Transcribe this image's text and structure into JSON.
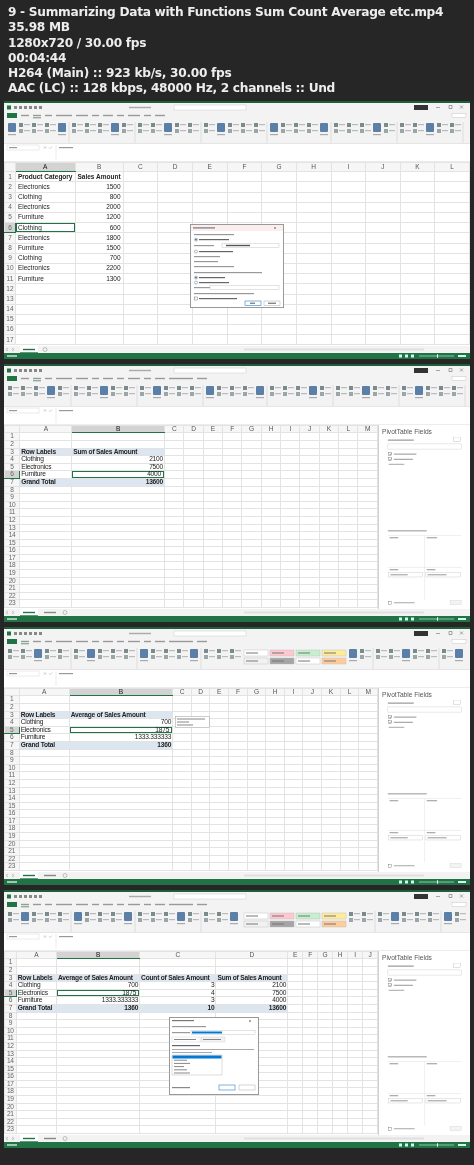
{
  "header": {
    "lines": [
      "9 - Summarizing Data with Functions Sum Count Average etc.mp4",
      "35.98 MB",
      "1280x720 / 30.00 fps",
      "00:04:44",
      "H264 (Main) :: 923 kb/s, 30.00 fps",
      "AAC (LC) :: 128 kbps, 48000 Hz, 2 channels :: Und"
    ]
  },
  "frames": [
    {
      "kind": "source",
      "overlay": {
        "kind": "create_pivot_dialog"
      },
      "columns": [
        {
          "label": "A",
          "selected": true
        },
        {
          "label": "B",
          "selected": false
        },
        {
          "label": "C",
          "selected": false
        },
        {
          "label": "D",
          "selected": false
        },
        {
          "label": "E",
          "selected": false
        },
        {
          "label": "F",
          "selected": false
        },
        {
          "label": "G",
          "selected": false
        },
        {
          "label": "H",
          "selected": false
        },
        {
          "label": "I",
          "selected": false
        },
        {
          "label": "J",
          "selected": false
        },
        {
          "label": "K",
          "selected": false
        },
        {
          "label": "L",
          "selected": false
        }
      ],
      "rows": [
        {
          "label": "1",
          "active": false,
          "kind": "field_header",
          "cells": [
            "Product Category",
            "Sales Amount"
          ]
        },
        {
          "label": "2",
          "active": false,
          "kind": "item",
          "cells": [
            "Electronics",
            "1500"
          ]
        },
        {
          "label": "3",
          "active": false,
          "kind": "item",
          "cells": [
            "Clothing",
            "800"
          ]
        },
        {
          "label": "4",
          "active": false,
          "kind": "item",
          "cells": [
            "Electronics",
            "2000"
          ]
        },
        {
          "label": "5",
          "active": false,
          "kind": "item",
          "cells": [
            "Furniture",
            "1200"
          ]
        },
        {
          "label": "6",
          "active": true,
          "kind": "item",
          "cells": [
            "Clothing",
            "600"
          ]
        },
        {
          "label": "7",
          "active": false,
          "kind": "item",
          "cells": [
            "Electronics",
            "1800"
          ]
        },
        {
          "label": "8",
          "active": false,
          "kind": "item",
          "cells": [
            "Furniture",
            "1500"
          ]
        },
        {
          "label": "9",
          "active": false,
          "kind": "item",
          "cells": [
            "Clothing",
            "700"
          ]
        },
        {
          "label": "10",
          "active": false,
          "kind": "item",
          "cells": [
            "Electronics",
            "2200"
          ]
        },
        {
          "label": "11",
          "active": false,
          "kind": "item",
          "cells": [
            "Furniture",
            "1300"
          ]
        },
        {
          "label": "12",
          "active": false
        },
        {
          "label": "13",
          "active": false
        },
        {
          "label": "14",
          "active": false
        },
        {
          "label": "15",
          "active": false
        },
        {
          "label": "16",
          "active": false
        },
        {
          "label": "17",
          "active": false
        }
      ]
    },
    {
      "kind": "pivot",
      "panel_title": "PivotTable Fields",
      "columns": [
        {
          "label": "A",
          "selected": false
        },
        {
          "label": "B",
          "selected": true
        },
        {
          "label": "C",
          "selected": false
        },
        {
          "label": "D",
          "selected": false
        },
        {
          "label": "E",
          "selected": false
        },
        {
          "label": "F",
          "selected": false
        },
        {
          "label": "G",
          "selected": false
        },
        {
          "label": "H",
          "selected": false
        },
        {
          "label": "I",
          "selected": false
        },
        {
          "label": "J",
          "selected": false
        },
        {
          "label": "K",
          "selected": false
        },
        {
          "label": "L",
          "selected": false
        },
        {
          "label": "M",
          "selected": false
        }
      ],
      "rows": [
        {
          "label": "1",
          "active": false
        },
        {
          "label": "2",
          "active": false
        },
        {
          "label": "3",
          "active": false,
          "kind": "pivot_header",
          "cells": [
            "Row Labels",
            "Sum of Sales Amount"
          ]
        },
        {
          "label": "4",
          "active": false,
          "kind": "item",
          "cells": [
            "Clothing",
            "2100"
          ]
        },
        {
          "label": "5",
          "active": false,
          "kind": "item",
          "cells": [
            "Electronics",
            "7500"
          ]
        },
        {
          "label": "6",
          "active": true,
          "kind": "item",
          "cells": [
            "Furniture",
            "4000"
          ]
        },
        {
          "label": "7",
          "active": false,
          "kind": "total",
          "cells": [
            "Grand Total",
            "13600"
          ]
        },
        {
          "label": "8",
          "active": false
        },
        {
          "label": "9",
          "active": false
        },
        {
          "label": "10",
          "active": false
        },
        {
          "label": "11",
          "active": false
        },
        {
          "label": "12",
          "active": false
        },
        {
          "label": "13",
          "active": false
        },
        {
          "label": "14",
          "active": false
        },
        {
          "label": "15",
          "active": false
        },
        {
          "label": "16",
          "active": false
        },
        {
          "label": "17",
          "active": false
        },
        {
          "label": "18",
          "active": false
        },
        {
          "label": "19",
          "active": false
        },
        {
          "label": "20",
          "active": false
        },
        {
          "label": "21",
          "active": false
        },
        {
          "label": "22",
          "active": false
        },
        {
          "label": "23",
          "active": false
        }
      ]
    },
    {
      "kind": "pivot",
      "panel_title": "PivotTable Fields",
      "overlay": {
        "kind": "tooltip"
      },
      "columns": [
        {
          "label": "A",
          "selected": false
        },
        {
          "label": "B",
          "selected": true
        },
        {
          "label": "C",
          "selected": false
        },
        {
          "label": "D",
          "selected": false
        },
        {
          "label": "E",
          "selected": false
        },
        {
          "label": "F",
          "selected": false
        },
        {
          "label": "G",
          "selected": false
        },
        {
          "label": "H",
          "selected": false
        },
        {
          "label": "I",
          "selected": false
        },
        {
          "label": "J",
          "selected": false
        },
        {
          "label": "K",
          "selected": false
        },
        {
          "label": "L",
          "selected": false
        },
        {
          "label": "M",
          "selected": false
        }
      ],
      "rows": [
        {
          "label": "1",
          "active": false
        },
        {
          "label": "2",
          "active": false
        },
        {
          "label": "3",
          "active": false,
          "kind": "pivot_header",
          "cells": [
            "Row Labels",
            "Average of Sales Amount"
          ]
        },
        {
          "label": "4",
          "active": false,
          "kind": "item",
          "cells": [
            "Clothing",
            "700"
          ]
        },
        {
          "label": "5",
          "active": true,
          "kind": "item",
          "cells": [
            "Electronics",
            "1875"
          ]
        },
        {
          "label": "6",
          "active": false,
          "kind": "item",
          "cells": [
            "Furniture",
            "1333.333333"
          ]
        },
        {
          "label": "7",
          "active": false,
          "kind": "total",
          "cells": [
            "Grand Total",
            "1360"
          ]
        },
        {
          "label": "8",
          "active": false
        },
        {
          "label": "9",
          "active": false
        },
        {
          "label": "10",
          "active": false
        },
        {
          "label": "11",
          "active": false
        },
        {
          "label": "12",
          "active": false
        },
        {
          "label": "13",
          "active": false
        },
        {
          "label": "14",
          "active": false
        },
        {
          "label": "15",
          "active": false
        },
        {
          "label": "16",
          "active": false
        },
        {
          "label": "17",
          "active": false
        },
        {
          "label": "18",
          "active": false
        },
        {
          "label": "19",
          "active": false
        },
        {
          "label": "20",
          "active": false
        },
        {
          "label": "21",
          "active": false
        },
        {
          "label": "22",
          "active": false
        },
        {
          "label": "23",
          "active": false
        }
      ]
    },
    {
      "kind": "pivot",
      "panel_title": "PivotTable Fields",
      "overlay": {
        "kind": "value_field_dialog"
      },
      "columns": [
        {
          "label": "A",
          "selected": false
        },
        {
          "label": "B",
          "selected": true
        },
        {
          "label": "C",
          "selected": false
        },
        {
          "label": "D",
          "selected": false
        },
        {
          "label": "E",
          "selected": false
        },
        {
          "label": "F",
          "selected": false
        },
        {
          "label": "G",
          "selected": false
        },
        {
          "label": "H",
          "selected": false
        },
        {
          "label": "I",
          "selected": false
        },
        {
          "label": "J",
          "selected": false
        }
      ],
      "rows": [
        {
          "label": "1",
          "active": false
        },
        {
          "label": "2",
          "active": false
        },
        {
          "label": "3",
          "active": false,
          "kind": "pivot_header",
          "cells": [
            "Row Labels",
            "Average of Sales Amount",
            "Count of Sales Amount",
            "Sum of Sales Amount"
          ]
        },
        {
          "label": "4",
          "active": false,
          "kind": "item",
          "cells": [
            "Clothing",
            "700",
            "3",
            "2100"
          ]
        },
        {
          "label": "5",
          "active": true,
          "kind": "item",
          "cells": [
            "Electronics",
            "1875",
            "4",
            "7500"
          ]
        },
        {
          "label": "6",
          "active": false,
          "kind": "item",
          "cells": [
            "Furniture",
            "1333.333333",
            "3",
            "4000"
          ]
        },
        {
          "label": "7",
          "active": false,
          "kind": "total",
          "cells": [
            "Grand Total",
            "1360",
            "10",
            "13600"
          ]
        },
        {
          "label": "8",
          "active": false
        },
        {
          "label": "9",
          "active": false
        },
        {
          "label": "10",
          "active": false
        },
        {
          "label": "11",
          "active": false
        },
        {
          "label": "12",
          "active": false
        },
        {
          "label": "13",
          "active": false
        },
        {
          "label": "14",
          "active": false
        },
        {
          "label": "15",
          "active": false
        },
        {
          "label": "16",
          "active": false
        },
        {
          "label": "17",
          "active": false
        },
        {
          "label": "18",
          "active": false
        },
        {
          "label": "19",
          "active": false
        },
        {
          "label": "20",
          "active": false
        },
        {
          "label": "21",
          "active": false
        },
        {
          "label": "22",
          "active": false
        },
        {
          "label": "23",
          "active": false
        }
      ]
    }
  ]
}
